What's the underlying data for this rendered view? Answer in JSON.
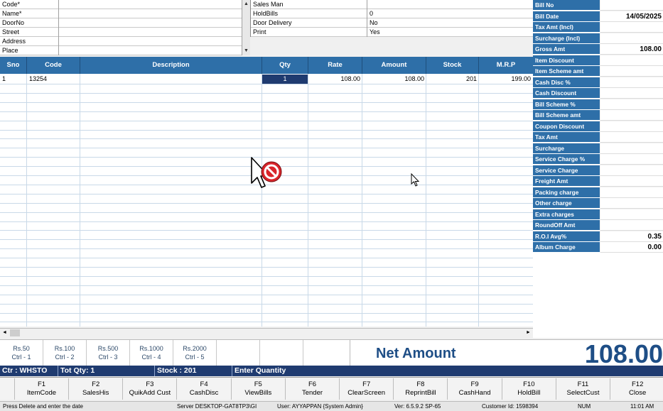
{
  "customer_form": {
    "fields": [
      {
        "label": "Code*",
        "value": ""
      },
      {
        "label": "Name*",
        "value": ""
      },
      {
        "label": "DoorNo",
        "value": ""
      },
      {
        "label": "Street",
        "value": ""
      },
      {
        "label": "Address",
        "value": ""
      },
      {
        "label": "Place",
        "value": ""
      }
    ]
  },
  "sales_form": {
    "fields": [
      {
        "label": "Sales Man",
        "value": ""
      },
      {
        "label": "HoldBills",
        "value": "0"
      },
      {
        "label": "Door Delivery",
        "value": "No"
      },
      {
        "label": "Print",
        "value": "Yes"
      }
    ]
  },
  "grid": {
    "columns": [
      "Sno",
      "Code",
      "Description",
      "Qty",
      "Rate",
      "Amount",
      "Stock",
      "M.R.P"
    ],
    "rows": [
      {
        "sno": "1",
        "code": "13254",
        "description": "",
        "qty": "1",
        "rate": "108.00",
        "amount": "108.00",
        "stock": "201",
        "mrp": "199.00"
      }
    ]
  },
  "summary": [
    {
      "label": "Bill No",
      "value": ""
    },
    {
      "label": "Bill Date",
      "value": "14/05/2025"
    },
    {
      "label": "Tax Amt (Incl)",
      "value": ""
    },
    {
      "label": "Surcharge (Incl)",
      "value": ""
    },
    {
      "label": "Gross Amt",
      "value": "108.00"
    },
    {
      "label": "Item Discount",
      "value": ""
    },
    {
      "label": "Item Scheme amt",
      "value": ""
    },
    {
      "label": "Cash Disc %",
      "value": ""
    },
    {
      "label": "Cash Discount",
      "value": ""
    },
    {
      "label": "Bill Scheme %",
      "value": ""
    },
    {
      "label": "Bill Scheme amt",
      "value": ""
    },
    {
      "label": "Coupon Discount",
      "value": ""
    },
    {
      "label": "Tax Amt",
      "value": ""
    },
    {
      "label": "Surcharge",
      "value": ""
    },
    {
      "label": "Service Charge %",
      "value": ""
    },
    {
      "label": "Service Charge",
      "value": ""
    },
    {
      "label": "Freight Amt",
      "value": ""
    },
    {
      "label": "Packing charge",
      "value": ""
    },
    {
      "label": "Other charge",
      "value": ""
    },
    {
      "label": "Extra charges",
      "value": ""
    },
    {
      "label": "RoundOff Amt",
      "value": ""
    },
    {
      "label": "R.O.I Avg%",
      "value": "0.35"
    },
    {
      "label": "Album Charge",
      "value": "0.00"
    }
  ],
  "denominations": [
    {
      "amount": "Rs.50",
      "shortcut": "Ctrl - 1"
    },
    {
      "amount": "Rs.100",
      "shortcut": "Ctrl - 2"
    },
    {
      "amount": "Rs.500",
      "shortcut": "Ctrl - 3"
    },
    {
      "amount": "Rs.1000",
      "shortcut": "Ctrl - 4"
    },
    {
      "amount": "Rs.2000",
      "shortcut": "Ctrl - 5"
    }
  ],
  "net_amount": {
    "label": "Net Amount",
    "value": "108.00"
  },
  "status_bar": {
    "counter": "Ctr : WHSTO",
    "tot_qty": "Tot Qty: 1",
    "stock": "Stock : 201",
    "prompt": "Enter Quantity"
  },
  "function_keys": [
    {
      "key": "F1",
      "label": "ItemCode"
    },
    {
      "key": "F2",
      "label": "SalesHis"
    },
    {
      "key": "F3",
      "label": "QuikAdd Cust"
    },
    {
      "key": "F4",
      "label": "CashDisc"
    },
    {
      "key": "F5",
      "label": "ViewBills"
    },
    {
      "key": "F6",
      "label": "Tender"
    },
    {
      "key": "F7",
      "label": "ClearScreen"
    },
    {
      "key": "F8",
      "label": "ReprintBill"
    },
    {
      "key": "F9",
      "label": "CashHand"
    },
    {
      "key": "F10",
      "label": "HoldBill"
    },
    {
      "key": "F11",
      "label": "SelectCust"
    },
    {
      "key": "F12",
      "label": "Close"
    }
  ],
  "footer": {
    "hint": "Press Delete and enter the date",
    "server": "Server  DESKTOP-GAT8TP3\\GI",
    "user": "User: AYYAPPAN {System Admin}",
    "version": "Ver: 6.5.9.2 SP-65",
    "customer_id": "Customer Id: 1598394",
    "num": "NUM",
    "time": "11:01 AM"
  },
  "colors": {
    "header_blue": "#2e6fa8",
    "status_navy": "#1f3b70",
    "net_amount_text": "#1e4e86",
    "cursor_stop_red": "#d9252b"
  }
}
